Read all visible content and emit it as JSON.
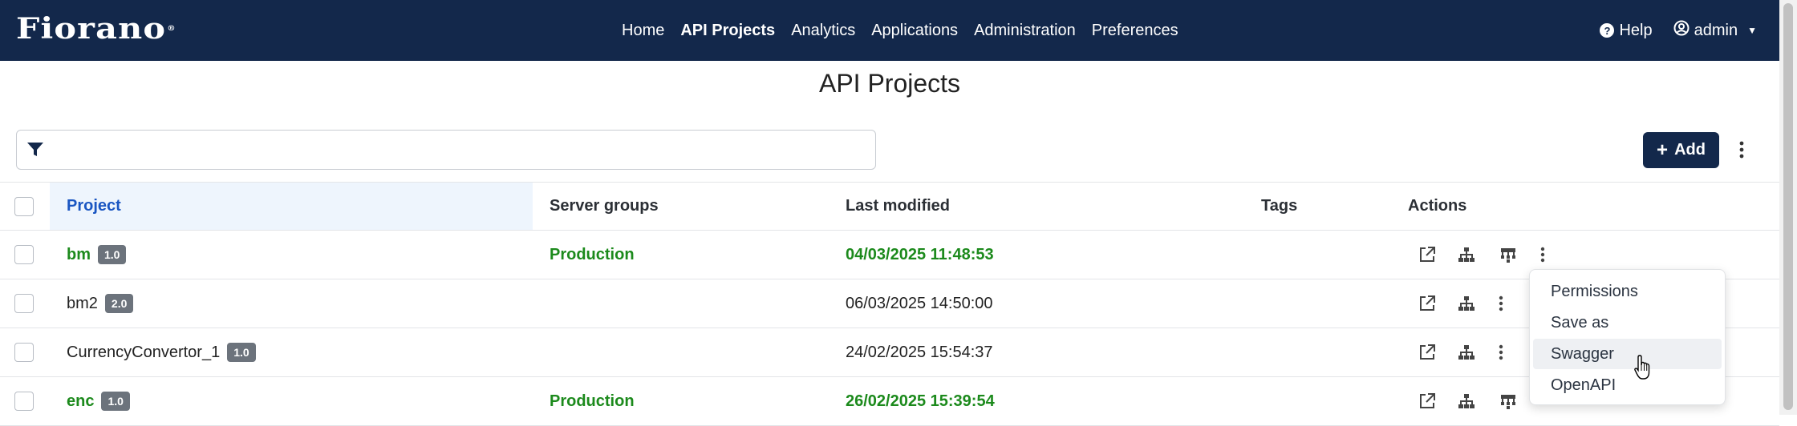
{
  "app": {
    "logo": "Fiorano",
    "logo_mark": "®",
    "nav": [
      {
        "label": "Home"
      },
      {
        "label": "API Projects",
        "active": true
      },
      {
        "label": "Analytics"
      },
      {
        "label": "Applications"
      },
      {
        "label": "Administration"
      },
      {
        "label": "Preferences"
      }
    ],
    "help_label": "Help",
    "user_label": "admin",
    "brand_color": "#13284b"
  },
  "page": {
    "title": "API Projects",
    "filter_placeholder": "",
    "add_label": "Add"
  },
  "table": {
    "columns": [
      "Project",
      "Server groups",
      "Last modified",
      "Tags",
      "Actions"
    ],
    "rows": [
      {
        "name": "bm",
        "version": "1.0",
        "server_group": "Production",
        "last_modified": "04/03/2025 11:48:53",
        "tags": "",
        "highlight": true
      },
      {
        "name": "bm2",
        "version": "2.0",
        "server_group": "",
        "last_modified": "06/03/2025 14:50:00",
        "tags": "",
        "highlight": false
      },
      {
        "name": "CurrencyConvertor_1",
        "version": "1.0",
        "server_group": "",
        "last_modified": "24/02/2025 15:54:37",
        "tags": "",
        "highlight": false
      },
      {
        "name": "enc",
        "version": "1.0",
        "server_group": "Production",
        "last_modified": "26/02/2025 15:39:54",
        "tags": "",
        "highlight": true
      }
    ]
  },
  "context_menu": {
    "items": [
      "Permissions",
      "Save as",
      "Swagger",
      "OpenAPI"
    ],
    "hovered": "Swagger"
  },
  "colors": {
    "production_green": "#1c8a1c",
    "header_link_blue": "#1a56c2",
    "badge_gray": "#6c737c"
  }
}
